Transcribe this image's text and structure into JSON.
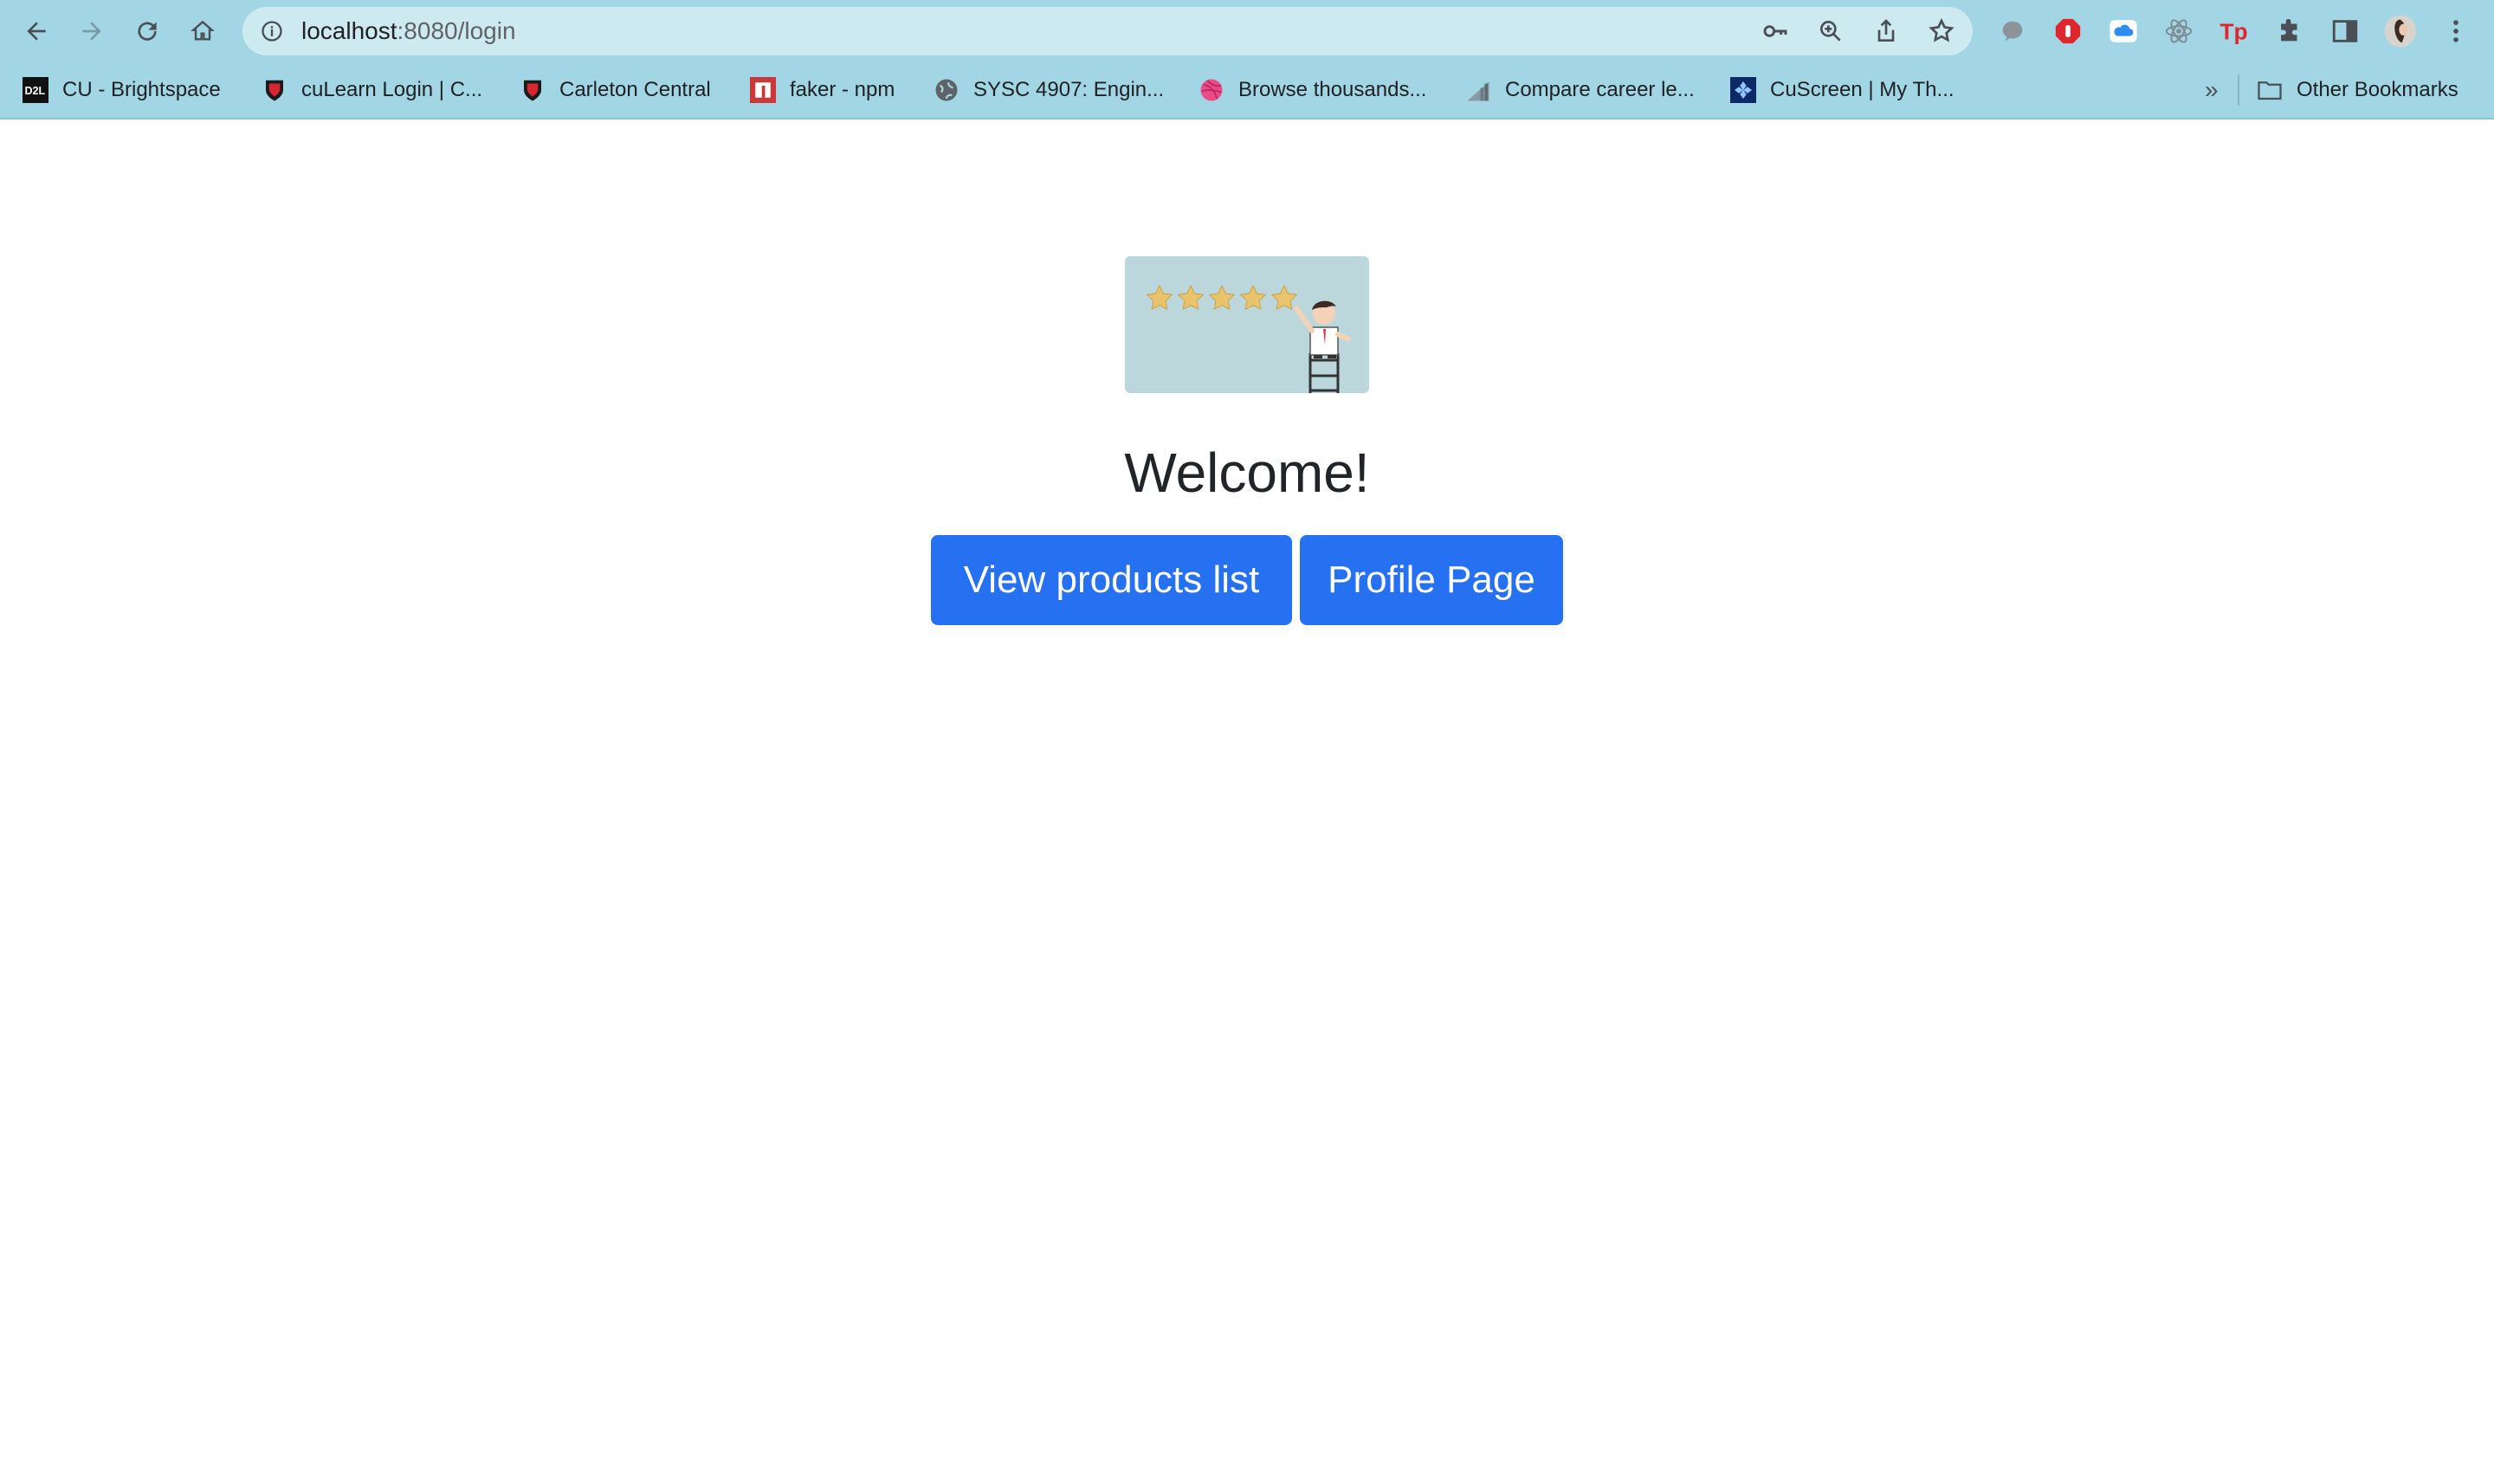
{
  "browser": {
    "url_host": "localhost",
    "url_rest": ":8080/login",
    "bookmarks": [
      {
        "label": "CU - Brightspace",
        "icon": "d2l-icon"
      },
      {
        "label": "cuLearn Login | C...",
        "icon": "carleton-icon"
      },
      {
        "label": "Carleton Central",
        "icon": "carleton-icon"
      },
      {
        "label": "faker - npm",
        "icon": "npm-icon"
      },
      {
        "label": "SYSC 4907: Engin...",
        "icon": "globe-icon"
      },
      {
        "label": "Browse thousands...",
        "icon": "dribbble-icon"
      },
      {
        "label": "Compare career le...",
        "icon": "chart-icon"
      },
      {
        "label": "CuScreen | My Th...",
        "icon": "cuscreen-icon"
      }
    ],
    "overflow_label": "»",
    "other_bookmarks": "Other Bookmarks",
    "colors": {
      "chrome": "#a2d6e4",
      "omnibox": "#cdeaf1"
    }
  },
  "page": {
    "title": "Welcome!",
    "buttons": {
      "products": "View products list",
      "profile": "Profile Page"
    },
    "hero_image": "five-star-rating-illustration",
    "colors": {
      "button": "#2670f2",
      "hero_bg": "#bcd7dc"
    }
  }
}
